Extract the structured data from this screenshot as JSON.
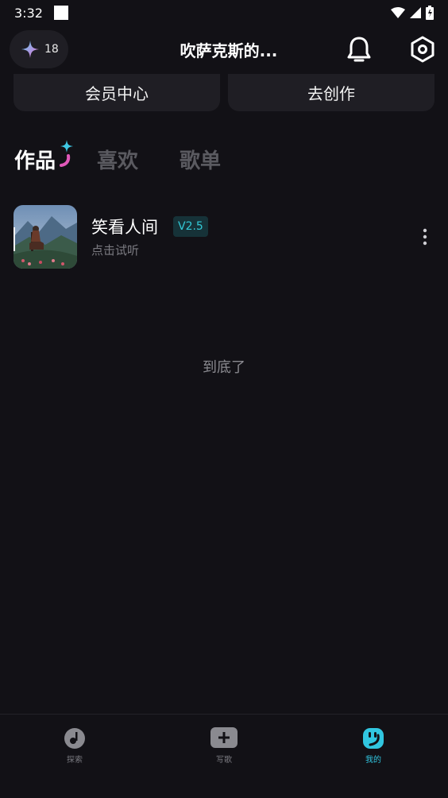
{
  "status_bar": {
    "time": "3:32"
  },
  "header": {
    "credits": "18",
    "title": "吹萨克斯的...",
    "icons": [
      "sparkle-icon",
      "bell-icon",
      "settings-hexagon-icon"
    ]
  },
  "actions": {
    "member_center": "会员中心",
    "go_create": "去创作"
  },
  "tabs": [
    {
      "label": "作品"
    },
    {
      "label": "喜欢"
    },
    {
      "label": "歌单"
    }
  ],
  "songs": [
    {
      "title": "笑看人间",
      "version": "V2.5",
      "subtitle": "点击试听"
    }
  ],
  "end_text": "到底了",
  "nav": {
    "explore": "探索",
    "write": "写歌",
    "mine": "我的"
  },
  "colors": {
    "background": "#121116",
    "card": "#1f1e24",
    "accent": "#31c6e0",
    "inactive": "#5a5a60"
  }
}
